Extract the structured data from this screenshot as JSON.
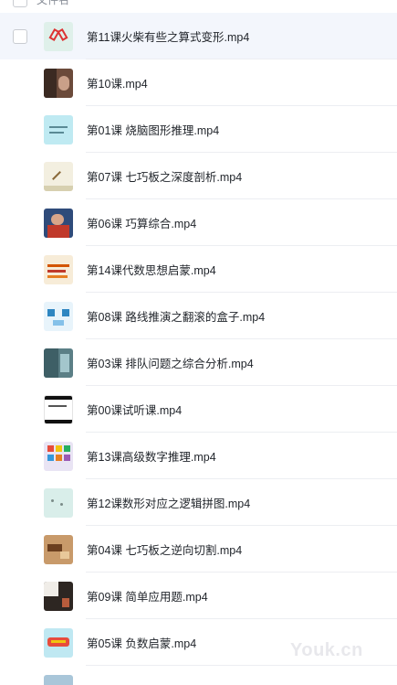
{
  "header": {
    "label": "文件名"
  },
  "files": [
    {
      "name": "第11课火柴有些之算式变形.mp4",
      "selected": true
    },
    {
      "name": "第10课.mp4",
      "selected": false
    },
    {
      "name": "第01课 烧脑图形推理.mp4",
      "selected": false
    },
    {
      "name": "第07课 七巧板之深度剖析.mp4",
      "selected": false
    },
    {
      "name": "第06课 巧算综合.mp4",
      "selected": false
    },
    {
      "name": "第14课代数思想启蒙.mp4",
      "selected": false
    },
    {
      "name": "第08课 路线推演之翻滚的盒子.mp4",
      "selected": false
    },
    {
      "name": "第03课 排队问题之综合分析.mp4",
      "selected": false
    },
    {
      "name": "第00课试听课.mp4",
      "selected": false
    },
    {
      "name": "第13课高级数字推理.mp4",
      "selected": false
    },
    {
      "name": "第12课数形对应之逻辑拼图.mp4",
      "selected": false
    },
    {
      "name": "第04课 七巧板之逆向切割.mp4",
      "selected": false
    },
    {
      "name": "第09课 简单应用题.mp4",
      "selected": false
    },
    {
      "name": "第05课 负数启蒙.mp4",
      "selected": false
    }
  ],
  "watermark": "Youk.cn"
}
